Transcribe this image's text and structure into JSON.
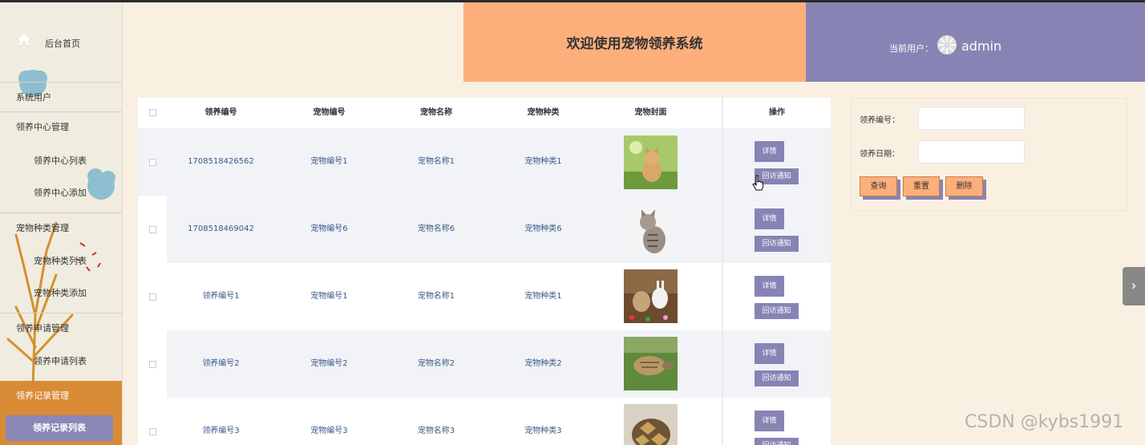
{
  "sidebar": {
    "home": "后台首页",
    "items": [
      {
        "label": "系统用户",
        "type": "top"
      },
      {
        "label": "领养中心管理",
        "type": "top"
      },
      {
        "label": "领养中心列表",
        "type": "sub"
      },
      {
        "label": "领养中心添加",
        "type": "sub"
      },
      {
        "label": "宠物种类管理",
        "type": "top"
      },
      {
        "label": "宠物种类列表",
        "type": "sub"
      },
      {
        "label": "宠物种类添加",
        "type": "sub"
      },
      {
        "label": "领养申请管理",
        "type": "top"
      },
      {
        "label": "领养申请列表",
        "type": "sub"
      },
      {
        "label": "领养记录管理",
        "type": "top"
      },
      {
        "label": "领养记录列表",
        "type": "sub"
      }
    ]
  },
  "header": {
    "title": "欢迎使用宠物领养系统",
    "user_label": "当前用户：",
    "username": "admin"
  },
  "table": {
    "columns": [
      "领养编号",
      "宠物编号",
      "宠物名称",
      "宠物种类",
      "宠物封面",
      "操作"
    ],
    "detail_label": "详情",
    "notify_label": "回访通知",
    "rows": [
      {
        "adopt_no": "1708518426562",
        "pet_no": "宠物编号1",
        "pet_name": "宠物名称1",
        "pet_type": "宠物种类1",
        "cover": "kitten-grass"
      },
      {
        "adopt_no": "1708518469042",
        "pet_no": "宠物编号6",
        "pet_name": "宠物名称6",
        "pet_type": "宠物种类6",
        "cover": "tabby-cat"
      },
      {
        "adopt_no": "领养编号1",
        "pet_no": "宠物编号1",
        "pet_name": "宠物名称1",
        "pet_type": "宠物种类1",
        "cover": "rabbits"
      },
      {
        "adopt_no": "领养编号2",
        "pet_no": "宠物编号2",
        "pet_name": "宠物名称2",
        "pet_type": "宠物种类2",
        "cover": "turtle"
      },
      {
        "adopt_no": "领养编号3",
        "pet_no": "宠物编号3",
        "pet_name": "宠物名称3",
        "pet_type": "宠物种类3",
        "cover": "tortoise"
      }
    ]
  },
  "search": {
    "adopt_no_label": "领养编号：",
    "adopt_no_value": "",
    "adopt_date_label": "领养日期：",
    "adopt_date_value": "",
    "query_label": "查询",
    "reset_label": "重置",
    "delete_label": "删除"
  },
  "watermark": "CSDN @kybs1991",
  "colors": {
    "accent_orange": "#fdaf7b",
    "accent_purple": "#8784b5",
    "sidebar_active": "#d98a35",
    "background": "#faf0e2"
  }
}
